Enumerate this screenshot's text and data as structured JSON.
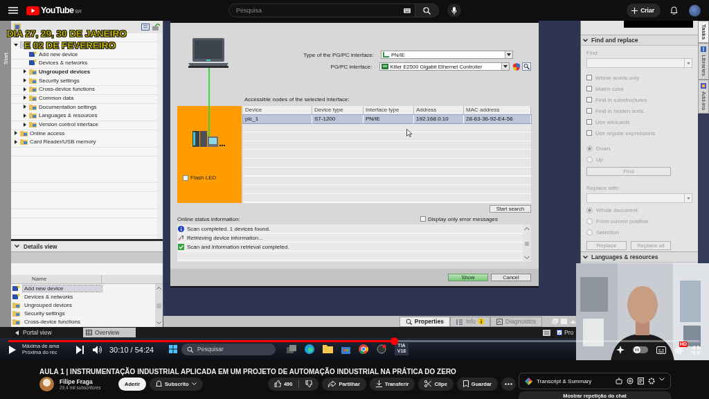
{
  "header": {
    "logo": "YouTube",
    "region": "BR",
    "search_placeholder": "Pesquisa",
    "create_button": "Criar"
  },
  "video": {
    "overlay_caption": [
      "DIA 27, 29, 30 DE JANEIRO",
      "E 02 DE FEVEREIRO"
    ],
    "start_tab": "Start",
    "project_tree": [
      {
        "expanded": true,
        "children": [
          {
            "label": "Add new device",
            "bold": false
          },
          {
            "label": "Devices & networks",
            "bold": false
          },
          {
            "label": "Ungrouped devices",
            "bold": true,
            "expanded": false
          },
          {
            "label": "Security settings",
            "bold": false,
            "expanded": false
          },
          {
            "label": "Cross-device functions",
            "bold": false,
            "expanded": false
          },
          {
            "label": "Common data",
            "bold": false,
            "expanded": false
          },
          {
            "label": "Documentation settings",
            "bold": false,
            "expanded": false
          },
          {
            "label": "Languages & resources",
            "bold": false,
            "expanded": false
          },
          {
            "label": "Version control interface",
            "bold": false,
            "expanded": false
          }
        ]
      },
      {
        "label": "Online access",
        "bold": false,
        "expanded": false
      },
      {
        "label": "Card Reader/USB memory",
        "bold": false,
        "expanded": false
      }
    ],
    "details_view": {
      "title": "Details view",
      "expanded": true,
      "column": "Name",
      "items": [
        {
          "label": "Add new device",
          "selected": true
        },
        {
          "label": "Devices & networks",
          "selected": false
        },
        {
          "label": "Ungrouped devices",
          "selected": false
        },
        {
          "label": "Security settings",
          "selected": false
        },
        {
          "label": "Cross-device functions",
          "selected": false
        }
      ]
    },
    "dialog": {
      "interface_type_label": "Type of the PG/PC interface:",
      "interface_type": "PN/IE",
      "interface_label": "PG/PC interface:",
      "interface": "Killer E2500 Gigabit Ethernet Controller",
      "nodes_label": "Accessible nodes of the selected interface:",
      "flash_led": {
        "label": "Flash LED",
        "checked": false
      },
      "columns": [
        "Device",
        "Device type",
        "Interface type",
        "Address",
        "MAC address"
      ],
      "rows": [
        {
          "cells": [
            "plc_1",
            "S7-1200",
            "PN/IE",
            "192.168.0.10",
            "28-63-36-92-E4-56"
          ],
          "selected": true
        }
      ],
      "start_search": "Start search",
      "status_label": "Online status information:",
      "errors_only": {
        "label": "Display only error messages",
        "checked": false
      },
      "messages": [
        {
          "kind": "info",
          "text": "Scan completed. 1 devices found."
        },
        {
          "kind": "progress",
          "text": "Retrieving device information..."
        },
        {
          "kind": "success",
          "text": "Scan and information retrieval completed."
        }
      ],
      "buttons": [
        {
          "label": "Show",
          "primary": true
        },
        {
          "label": "Cancel",
          "primary": false
        }
      ]
    },
    "bottom_tabs": [
      {
        "label": "Properties",
        "selected": true
      },
      {
        "label": "Info",
        "selected": false
      },
      {
        "label": "Diagnostics",
        "selected": false
      }
    ],
    "task_panel": {
      "title": "Find and replace",
      "disabled": true,
      "find_label": "Find:",
      "options": [
        {
          "label": "Whole words only",
          "checked": false
        },
        {
          "label": "Match case",
          "checked": false
        },
        {
          "label": "Find in substructures",
          "checked": false
        },
        {
          "label": "Find in hidden texts",
          "checked": false
        },
        {
          "label": "Use wildcards",
          "checked": false
        },
        {
          "label": "Use regular expressions",
          "checked": false
        }
      ],
      "direction": [
        {
          "label": "Down",
          "selected": true
        },
        {
          "label": "Up",
          "selected": false
        }
      ],
      "find_button": "Find",
      "replace_label": "Replace with:",
      "scope": [
        {
          "label": "Whole document",
          "selected": true
        },
        {
          "label": "From current position",
          "selected": false
        },
        {
          "label": "Selection",
          "selected": false
        }
      ],
      "replace_buttons": [
        "Replace",
        "Replace all"
      ],
      "next_section": "Languages & resources"
    },
    "side_tabs": [
      {
        "label": "Tasks",
        "selected": true
      },
      {
        "label": "Libraries",
        "selected": false
      },
      {
        "label": "Add-ins",
        "selected": false
      }
    ],
    "portal_view": "Portal view",
    "overview_tab": "Overview",
    "pro_option": {
      "label": "Pro",
      "checked": true
    },
    "taskbar": {
      "weather": [
        "Máxima de ama",
        "Próxima do rec"
      ],
      "search_placeholder": "Pesquisar",
      "tia_label": "TIA V18"
    },
    "player": {
      "level": 0.558,
      "time": "30:10 / 54:24",
      "quality_badge": "HD"
    },
    "webcam": {
      "kind": "picture"
    }
  },
  "info": {
    "title": "AULA 1 | INSTRUMENTAÇÃO INDUSTRIAL APLICADA EM UM PROJETO DE AUTOMAÇÃO INDUSTRIAL NA PRÁTICA DO ZERO",
    "channel": "Filipe Fraga",
    "subscribers": "29,4 mil subscritores",
    "join": "Aderir",
    "subscribed": "Subscrito",
    "likes": "490",
    "share": "Partilhar",
    "download": "Transferir",
    "clip": "Clipe",
    "save": "Guardar",
    "transcript": "Transcript & Summary",
    "chat_replay": "Mostrar repetição do chat"
  }
}
